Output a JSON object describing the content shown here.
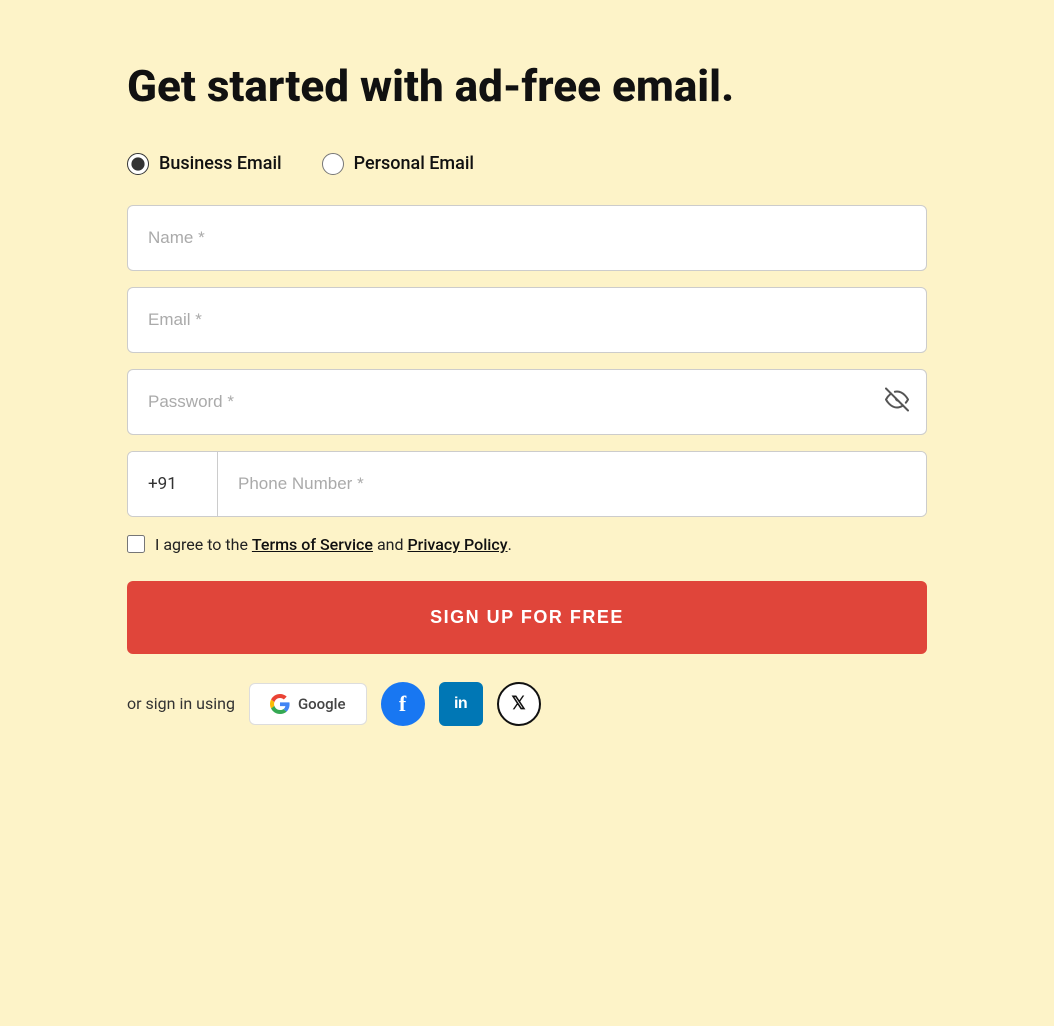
{
  "page": {
    "title": "Get started with ad-free email.",
    "background_color": "#fdf3c8"
  },
  "email_type": {
    "options": [
      {
        "id": "business",
        "label": "Business Email",
        "checked": true
      },
      {
        "id": "personal",
        "label": "Personal Email",
        "checked": false
      }
    ]
  },
  "form": {
    "name_placeholder": "Name *",
    "email_placeholder": "Email *",
    "password_placeholder": "Password *",
    "phone_country_code": "+91",
    "phone_placeholder": "Phone Number *"
  },
  "terms": {
    "text_before": "I agree to the ",
    "terms_link": "Terms of Service",
    "text_middle": " and ",
    "privacy_link": "Privacy Policy",
    "text_after": "."
  },
  "signup_button": {
    "label": "SIGN UP FOR FREE"
  },
  "social": {
    "text": "or sign in using",
    "google_label": "Google",
    "facebook_label": "f",
    "linkedin_label": "in",
    "x_label": "𝕏"
  }
}
